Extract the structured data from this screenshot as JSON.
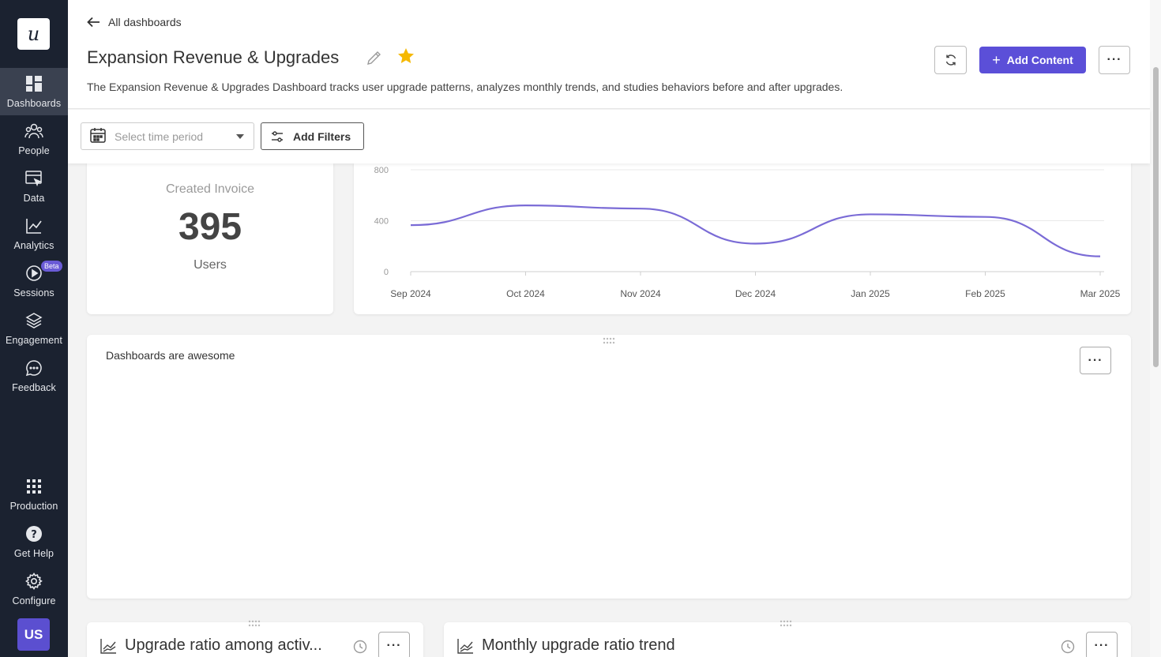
{
  "sidebar": {
    "logo": "u",
    "items": [
      {
        "label": "Dashboards",
        "icon": "dashboard-icon"
      },
      {
        "label": "People",
        "icon": "people-icon"
      },
      {
        "label": "Data",
        "icon": "data-icon"
      },
      {
        "label": "Analytics",
        "icon": "analytics-icon"
      },
      {
        "label": "Sessions",
        "icon": "sessions-icon",
        "badge": "Beta"
      },
      {
        "label": "Engagement",
        "icon": "layers-icon"
      },
      {
        "label": "Feedback",
        "icon": "chat-icon"
      },
      {
        "label": "Production",
        "icon": "grid-icon"
      },
      {
        "label": "Get Help",
        "icon": "help-icon"
      },
      {
        "label": "Configure",
        "icon": "gear-icon"
      }
    ],
    "avatar": "US"
  },
  "header": {
    "back_label": "All dashboards",
    "title": "Expansion Revenue & Upgrades",
    "description": "The Expansion Revenue & Upgrades Dashboard tracks user upgrade patterns, analyzes monthly trends, and studies behaviors before and after upgrades.",
    "add_content_label": "Add Content",
    "more_label": "···"
  },
  "filters": {
    "time_placeholder": "Select time period",
    "add_filters_label": "Add Filters"
  },
  "kpi": {
    "label": "Created Invoice",
    "value": "395",
    "unit": "Users"
  },
  "chart_data": {
    "type": "line",
    "x": [
      "Sep 2024",
      "Oct 2024",
      "Nov 2024",
      "Dec 2024",
      "Jan 2025",
      "Feb 2025",
      "Mar 2025"
    ],
    "series": [
      {
        "values": [
          365,
          520,
          495,
          220,
          450,
          430,
          120
        ],
        "color": "#7a6bd6"
      }
    ],
    "y_ticks": [
      "0",
      "400",
      "800"
    ],
    "ylim": [
      0,
      800
    ],
    "grid": true
  },
  "text_card": {
    "title": "Dashboards are awesome",
    "more_label": "···"
  },
  "bottom_cards": [
    {
      "title": "Upgrade ratio among activ...",
      "more_label": "···"
    },
    {
      "title": "Monthly upgrade ratio trend",
      "more_label": "···"
    }
  ],
  "colors": {
    "accent": "#5b4fd8",
    "sidebar_bg": "#1b2230",
    "star": "#f5b800",
    "line": "#7a6bd6"
  }
}
